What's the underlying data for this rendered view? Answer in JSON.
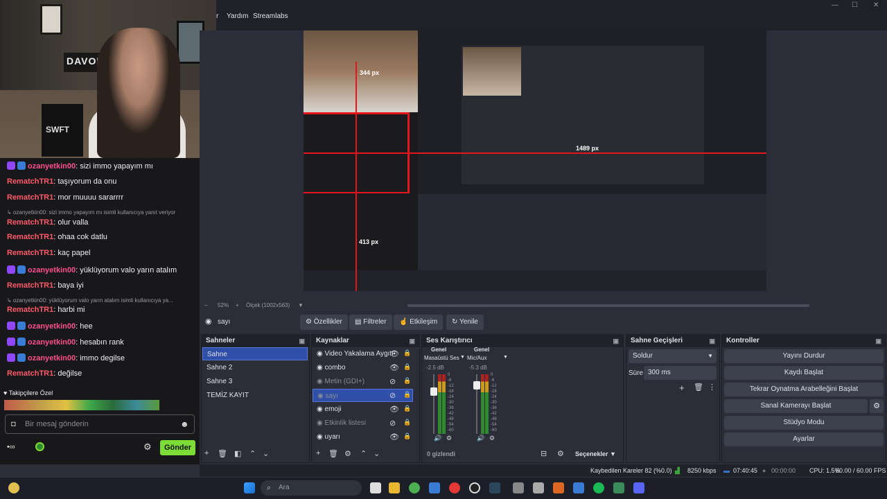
{
  "menubar": {
    "items": [
      "r",
      "Yardım",
      "Streamlabs"
    ]
  },
  "webcam": {
    "sign_text": "DAVOLT",
    "box_text": "SWFT"
  },
  "chat": {
    "messages": [
      {
        "type": "msg",
        "user": "ozanyetkin00",
        "color": "red",
        "badges": true,
        "text": ": sizi immo yapayım mı"
      },
      {
        "type": "msg",
        "user": "RematchTR1",
        "color": "red2",
        "badges": false,
        "text": ": taşıyorum da onu"
      },
      {
        "type": "msg",
        "user": "RematchTR1",
        "color": "red2",
        "badges": false,
        "text": ": mor muuuu sararrrr"
      },
      {
        "type": "reply",
        "text": "↳ ozanyetkin00: sizi immo yapayım mı isimli kullanıcıya yanıt veriyor"
      },
      {
        "type": "msg",
        "user": "RematchTR1",
        "color": "red2",
        "badges": false,
        "text": ": olur valla"
      },
      {
        "type": "msg",
        "user": "RematchTR1",
        "color": "red2",
        "badges": false,
        "text": ": ohaa cok datlu"
      },
      {
        "type": "msg",
        "user": "RematchTR1",
        "color": "red2",
        "badges": false,
        "text": ": kaç papel"
      },
      {
        "type": "msg",
        "user": "ozanyetkin00",
        "color": "red",
        "badges": true,
        "text": ": yüklüyorum valo yarın atalım"
      },
      {
        "type": "msg",
        "user": "RematchTR1",
        "color": "red2",
        "badges": false,
        "text": ": baya iyi"
      },
      {
        "type": "reply",
        "text": "↳ ozanyetkin00: yüklüyorum valo yarın atalım isimli kullanıcıya ya..."
      },
      {
        "type": "msg",
        "user": "RematchTR1",
        "color": "red2",
        "badges": false,
        "text": ": harbi mi"
      },
      {
        "type": "msg",
        "user": "ozanyetkin00",
        "color": "red",
        "badges": true,
        "text": ": hee"
      },
      {
        "type": "msg",
        "user": "ozanyetkin00",
        "color": "red",
        "badges": true,
        "text": ": hesabın rank"
      },
      {
        "type": "msg",
        "user": "ozanyetkin00",
        "color": "red",
        "badges": true,
        "text": ": immo degilse"
      },
      {
        "type": "msg",
        "user": "RematchTR1",
        "color": "red2",
        "badges": false,
        "text": ": değilse"
      }
    ],
    "followers_label": "Takipçilere Özel",
    "input_placeholder": "Bir mesaj gönderin",
    "send_label": "Gönder"
  },
  "preview": {
    "px_labels": [
      "344 px",
      "1489 px",
      "413 px"
    ],
    "zoom": "52%",
    "scale_label": "Ölçek (1002x563)"
  },
  "source_toolbar": {
    "current_source": "sayı",
    "buttons": [
      "Özellikler",
      "Filtreler",
      "Etkileşim",
      "Yenile"
    ]
  },
  "docks": {
    "scenes": {
      "title": "Sahneler",
      "items": [
        "Sahne",
        "Sahne 2",
        "Sahne 3",
        "TEMİZ KAYIT"
      ],
      "selected": 0
    },
    "sources": {
      "title": "Kaynaklar",
      "items": [
        {
          "name": "Video Yakalama Aygıtı",
          "hidden": false
        },
        {
          "name": "combo",
          "hidden": false
        },
        {
          "name": "Metin (GDI+)",
          "hidden": true
        },
        {
          "name": "sayı",
          "hidden": true,
          "selected": true
        },
        {
          "name": "emoji",
          "hidden": false
        },
        {
          "name": "Etkinlik listesi",
          "hidden": true
        },
        {
          "name": "uyarı",
          "hidden": false
        }
      ]
    },
    "mixer": {
      "title": "Ses Karıştırıcı",
      "channels": [
        {
          "tag": "Genel",
          "name": "Masaüstü Ses",
          "db": "-2.5 dB",
          "level": 0.22
        },
        {
          "tag": "Genel",
          "name": "Mic/Aux",
          "db": "-5.3 dB",
          "level": 0.12
        }
      ],
      "ticks": [
        "0",
        "-6",
        "-12",
        "-18",
        "-24",
        "-30",
        "-36",
        "-42",
        "-48",
        "-54",
        "-60"
      ],
      "hidden_count": "0 gizlendi",
      "options": "Seçenekler"
    },
    "transitions": {
      "title": "Sahne Geçişleri",
      "type": "Soldur",
      "duration_label": "Süre",
      "duration": "300 ms"
    },
    "controls": {
      "title": "Kontroller",
      "buttons": [
        "Yayını Durdur",
        "Kaydı Başlat",
        "Tekrar Oynatma Arabelleğini Başlat",
        "Sanal Kamerayı Başlat",
        "Stüdyo Modu",
        "Ayarlar"
      ]
    }
  },
  "status": {
    "dropped": "Kaybedilen Kareler 82 (%0.0)",
    "bitrate": "8250 kbps",
    "live_time": "07:40:45",
    "rec_time": "00:00:00",
    "cpu": "CPU: 1.5%",
    "fps": "60.00 / 60.00 FPS"
  },
  "taskbar": {
    "search_placeholder": "Ara"
  },
  "colors": {
    "accent": "#2f4fa8",
    "send": "#7cdd36",
    "red_line": "#e3161d"
  }
}
